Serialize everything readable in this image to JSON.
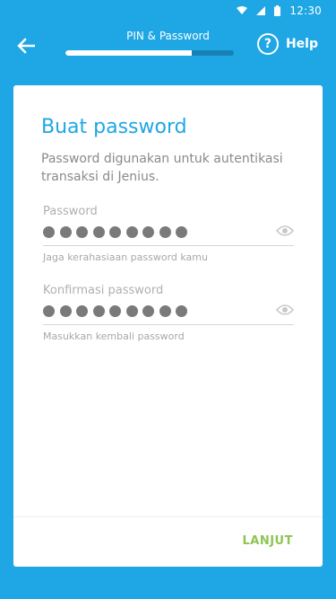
{
  "status_bar": {
    "time": "12:30",
    "icons": [
      "wifi-icon",
      "signal-icon",
      "battery-icon"
    ]
  },
  "header": {
    "title": "PIN & Password",
    "progress": 0.75,
    "help_label": "Help",
    "help_icon_glyph": "?"
  },
  "form": {
    "title": "Buat password",
    "description": "Password digunakan untuk autentikasi transaksi di Jenius.",
    "password": {
      "label": "Password",
      "masked_length": 9,
      "helper": "Jaga kerahasiaan password kamu"
    },
    "confirm": {
      "label": "Konfirmasi password",
      "masked_length": 9,
      "helper": "Masukkan kembali password"
    },
    "next_label": "LANJUT"
  },
  "colors": {
    "background": "#1ea7e4",
    "accent": "#1ea7e4",
    "next_button": "#8cc552"
  }
}
